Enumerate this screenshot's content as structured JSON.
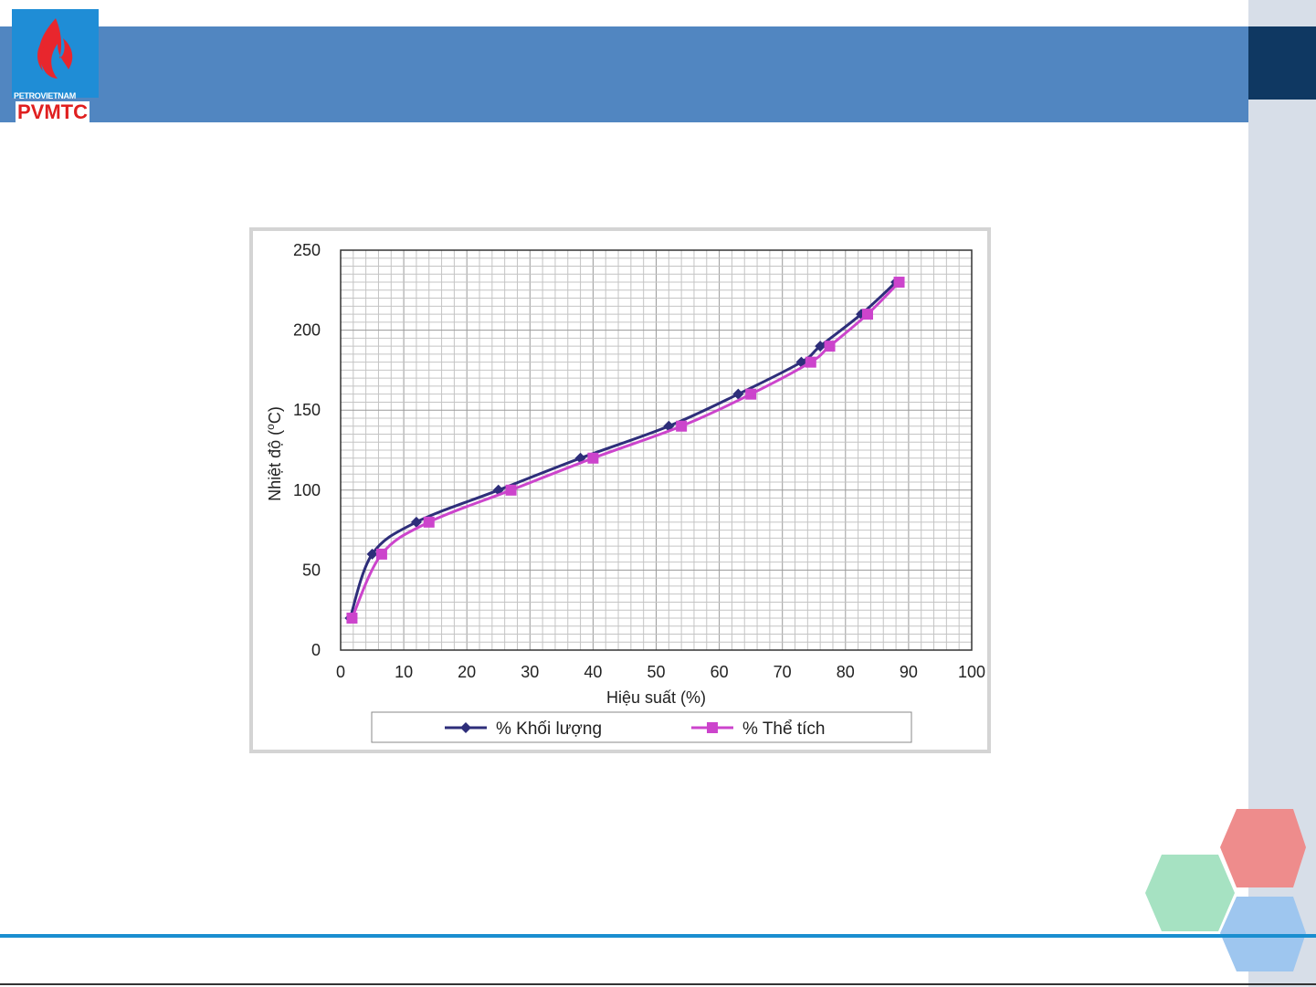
{
  "logo": {
    "brand": "PETROVIETNAM",
    "text": "PVMTC"
  },
  "colors": {
    "banner": "#5186c1",
    "banner_dark": "#0f3862",
    "side_strip": "#d7dee8",
    "bottom_line": "#1a8ed0",
    "series_mass": "#2e2e7a",
    "series_volume": "#cc44cc",
    "hex_red": "#ee8c8c",
    "hex_green": "#a6e2c2",
    "hex_blue": "#9ec6ef"
  },
  "chart_data": {
    "type": "line",
    "title": "",
    "xlabel": "Hiệu suất (%)",
    "ylabel": "Nhiệt độ (°C)",
    "ylabel_parts": [
      "Nhiệt độ (",
      "o",
      "C)"
    ],
    "xlim": [
      0,
      100
    ],
    "ylim": [
      0,
      250
    ],
    "x_ticks": [
      "0",
      "10",
      "20",
      "30",
      "40",
      "50",
      "60",
      "70",
      "80",
      "90",
      "100"
    ],
    "y_ticks": [
      "0",
      "50",
      "100",
      "150",
      "200",
      "250"
    ],
    "grid": true,
    "legend_position": "bottom",
    "series": [
      {
        "name": "% Khối lượng",
        "marker": "diamond",
        "color": "#2e2e7a",
        "points": [
          [
            1.5,
            20
          ],
          [
            5,
            60
          ],
          [
            12,
            80
          ],
          [
            25,
            100
          ],
          [
            38,
            120
          ],
          [
            52,
            140
          ],
          [
            63,
            160
          ],
          [
            73,
            180
          ],
          [
            76,
            190
          ],
          [
            82.5,
            210
          ],
          [
            88,
            230
          ]
        ]
      },
      {
        "name": "% Thể tích",
        "marker": "square",
        "color": "#cc44cc",
        "points": [
          [
            1.8,
            20
          ],
          [
            6.5,
            60
          ],
          [
            14,
            80
          ],
          [
            27,
            100
          ],
          [
            40,
            120
          ],
          [
            54,
            140
          ],
          [
            65,
            160
          ],
          [
            74.5,
            180
          ],
          [
            77.5,
            190
          ],
          [
            83.5,
            210
          ],
          [
            88.5,
            230
          ]
        ]
      }
    ]
  }
}
